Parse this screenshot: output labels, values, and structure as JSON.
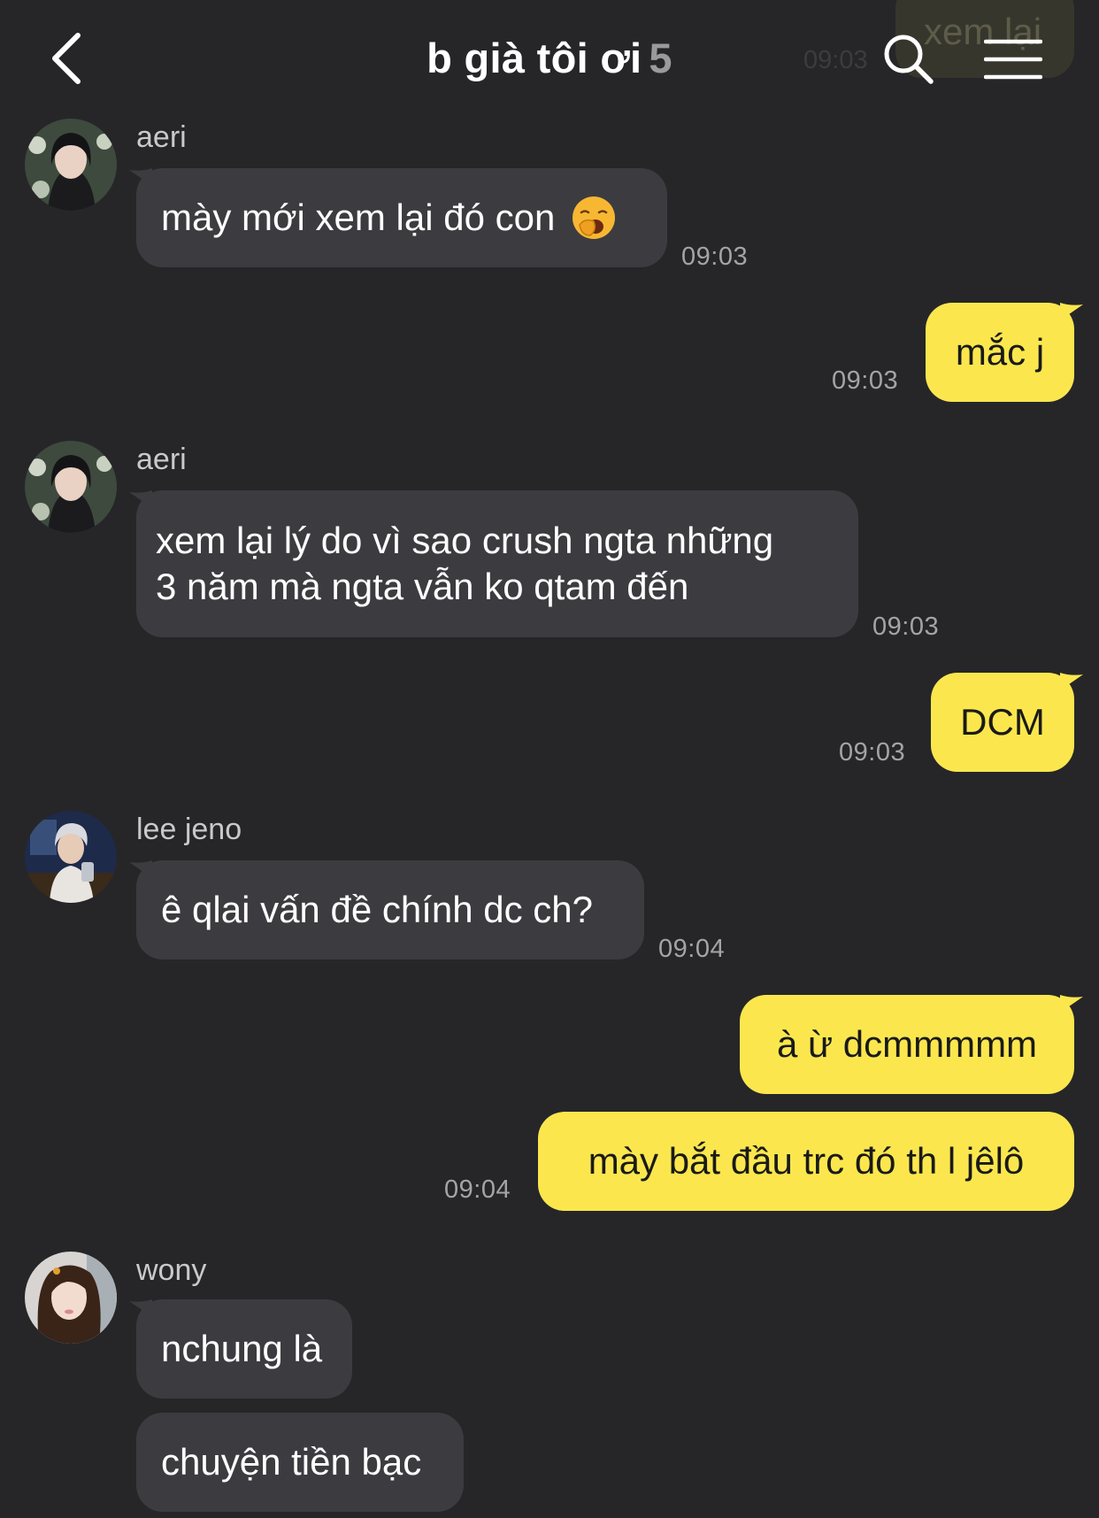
{
  "header": {
    "title": "b già tôi ơi",
    "member_count": "5"
  },
  "ghost": {
    "text": "xem lại",
    "time": "09:03"
  },
  "messages": [
    {
      "sender": "aeri",
      "text": "mày mới xem lại đó con",
      "emoji": "yawning-face-emoji",
      "time": "09:03",
      "side": "in"
    },
    {
      "text": "mắc j",
      "time": "09:03",
      "side": "out"
    },
    {
      "sender": "aeri",
      "line1": "xem lại lý do vì sao crush ngta những",
      "line2": "3 năm mà ngta vẫn ko qtam đến",
      "time": "09:03",
      "side": "in"
    },
    {
      "text": "DCM",
      "time": "09:03",
      "side": "out"
    },
    {
      "sender": "lee jeno",
      "text": "ê qlai vấn đề chính dc ch?",
      "time": "09:04",
      "side": "in"
    },
    {
      "text": "à ừ dcmmmmm",
      "side": "out"
    },
    {
      "text": "mày bắt đầu trc đó th l jêlô",
      "time": "09:04",
      "side": "out"
    },
    {
      "sender": "wony",
      "text": "nchung là",
      "side": "in"
    },
    {
      "text": "chuyện tiền bạc",
      "side": "in"
    }
  ],
  "colors": {
    "background": "#262629",
    "incoming_bubble": "#3c3c40",
    "outgoing_bubble": "#fbe74d"
  }
}
